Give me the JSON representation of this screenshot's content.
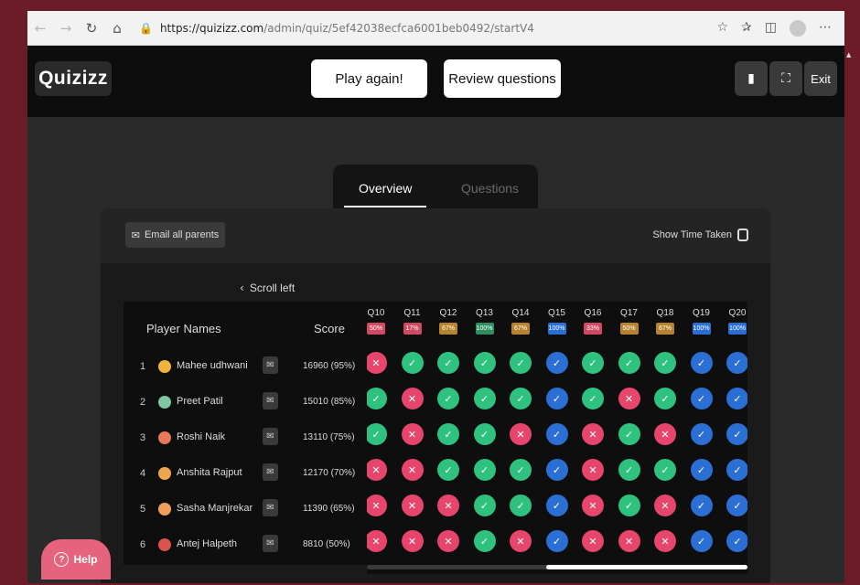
{
  "browser": {
    "url_host": "https://quizizz.com",
    "url_path": "/admin/quiz/5ef42038ecfca6001beb0492/startV4",
    "icons": [
      "back-icon",
      "forward-icon",
      "refresh-icon",
      "home-icon",
      "lock-icon",
      "favorite-icon",
      "collections-icon",
      "extensions-icon",
      "profile-icon",
      "more-icon"
    ]
  },
  "header": {
    "logo": "Quizizz",
    "play_again": "Play again!",
    "review_questions": "Review questions",
    "exit": "Exit"
  },
  "tabs": {
    "overview": "Overview",
    "questions": "Questions"
  },
  "panel": {
    "email_all": "Email all parents",
    "show_time_taken": "Show Time Taken",
    "scroll_left": "Scroll left"
  },
  "table": {
    "col_name": "Player Names",
    "col_score": "Score",
    "players": [
      {
        "rank": "1",
        "name": "Mahee udhwani",
        "score": "16960 (95%)",
        "avatar_color": "#f2b33d"
      },
      {
        "rank": "2",
        "name": "Preet Patil",
        "score": "15010 (85%)",
        "avatar_color": "#7ec8a0"
      },
      {
        "rank": "3",
        "name": "Roshi Naik",
        "score": "13110 (75%)",
        "avatar_color": "#e8785a"
      },
      {
        "rank": "4",
        "name": "Anshita Rajput",
        "score": "12170 (70%)",
        "avatar_color": "#f0a64a"
      },
      {
        "rank": "5",
        "name": "Sasha Manjrekar",
        "score": "11390 (65%)",
        "avatar_color": "#f29f5b"
      },
      {
        "rank": "6",
        "name": "Antej Halpeth",
        "score": "8810 (50%)",
        "avatar_color": "#d9534f"
      }
    ]
  },
  "questions": [
    {
      "label": "Q10",
      "pct": "50%",
      "color": "#d14a64"
    },
    {
      "label": "Q11",
      "pct": "17%",
      "color": "#d14a64"
    },
    {
      "label": "Q12",
      "pct": "67%",
      "color": "#b8832f"
    },
    {
      "label": "Q13",
      "pct": "100%",
      "color": "#2f8f5e"
    },
    {
      "label": "Q14",
      "pct": "67%",
      "color": "#b8832f"
    },
    {
      "label": "Q15",
      "pct": "100%",
      "color": "#2b6fd4"
    },
    {
      "label": "Q16",
      "pct": "33%",
      "color": "#d14a64"
    },
    {
      "label": "Q17",
      "pct": "50%",
      "color": "#b8832f"
    },
    {
      "label": "Q18",
      "pct": "67%",
      "color": "#b8832f"
    },
    {
      "label": "Q19",
      "pct": "100%",
      "color": "#2b6fd4"
    },
    {
      "label": "Q20",
      "pct": "100%",
      "color": "#2b6fd4"
    }
  ],
  "responses": [
    [
      "wrong",
      "correct",
      "correct",
      "correct",
      "correct",
      "neutral",
      "correct",
      "correct",
      "correct",
      "neutral",
      "neutral"
    ],
    [
      "correct",
      "wrong",
      "correct",
      "correct",
      "correct",
      "neutral",
      "correct",
      "wrong",
      "correct",
      "neutral",
      "neutral"
    ],
    [
      "correct",
      "wrong",
      "correct",
      "correct",
      "wrong",
      "neutral",
      "wrong",
      "correct",
      "wrong",
      "neutral",
      "neutral"
    ],
    [
      "wrong",
      "wrong",
      "correct",
      "correct",
      "correct",
      "neutral",
      "wrong",
      "correct",
      "correct",
      "neutral",
      "neutral"
    ],
    [
      "wrong",
      "wrong",
      "wrong",
      "correct",
      "correct",
      "neutral",
      "wrong",
      "correct",
      "wrong",
      "neutral",
      "neutral"
    ],
    [
      "wrong",
      "wrong",
      "wrong",
      "correct",
      "wrong",
      "neutral",
      "wrong",
      "wrong",
      "wrong",
      "neutral",
      "neutral"
    ]
  ],
  "help": {
    "label": "Help"
  }
}
